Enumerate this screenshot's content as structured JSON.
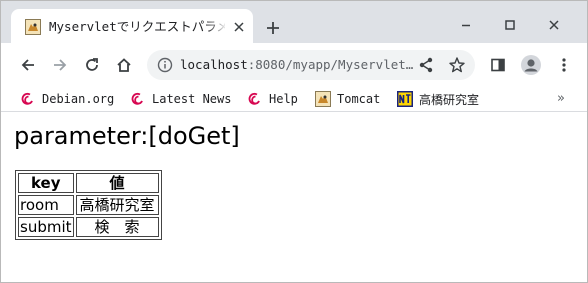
{
  "browser": {
    "tab": {
      "title": "Myservletでリクエストパラメータ",
      "favicon": "tomcat-icon"
    },
    "address_bar": {
      "host": "localhost",
      "rest": ":8080/myapp/Myservlet",
      "ellipsis": "…"
    },
    "bookmarks": [
      {
        "label": "Debian.org",
        "icon": "debian-icon"
      },
      {
        "label": "Latest News",
        "icon": "debian-icon"
      },
      {
        "label": "Help",
        "icon": "debian-icon"
      },
      {
        "label": "Tomcat",
        "icon": "tomcat-icon"
      },
      {
        "label": "高橋研究室",
        "icon": "nt-icon"
      }
    ],
    "bookmarks_more": "»"
  },
  "page": {
    "heading": "parameter:[doGet]",
    "table": {
      "headers": [
        "key",
        "値"
      ],
      "rows": [
        {
          "key": "room",
          "value": "高橋研究室"
        },
        {
          "key": "submit",
          "value": "検　索"
        }
      ]
    }
  },
  "colors": {
    "tabstrip": "#dee1e6",
    "omnibox": "#f1f3f4",
    "debian_red": "#d70751"
  }
}
